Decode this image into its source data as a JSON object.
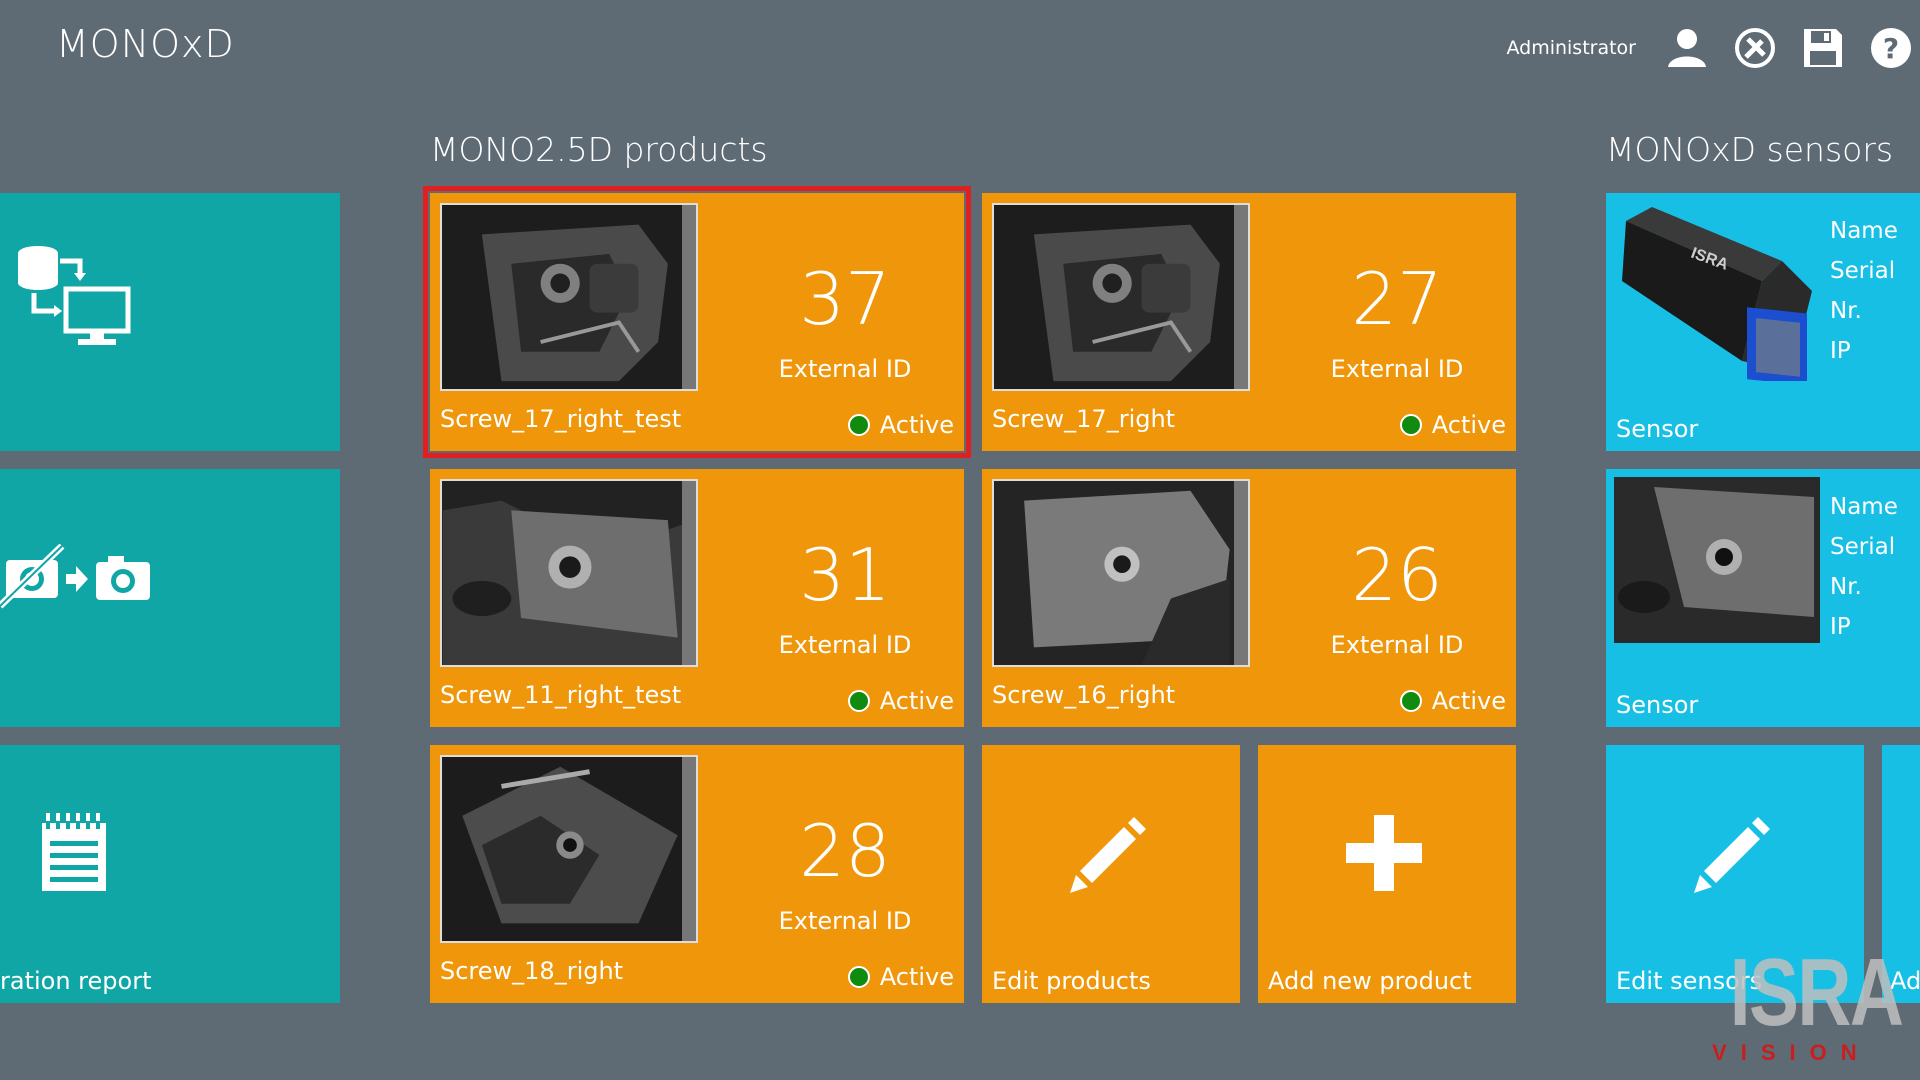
{
  "app": {
    "title": "MONOxD"
  },
  "header": {
    "user": "Administrator",
    "icons": [
      "user-icon",
      "tools-icon",
      "save-icon",
      "help-icon"
    ]
  },
  "left": {
    "tiles": [
      {
        "icon": "data-transfer-icon"
      },
      {
        "icon": "camera-replace-icon"
      },
      {
        "icon": "report-icon",
        "label": "ration report"
      }
    ]
  },
  "products": {
    "title": "MONO2.5D products",
    "items": [
      {
        "number": "37",
        "ext_label": "External ID",
        "name": "Screw_17_right_test",
        "status": "Active",
        "selected": true
      },
      {
        "number": "27",
        "ext_label": "External ID",
        "name": "Screw_17_right",
        "status": "Active"
      },
      {
        "number": "31",
        "ext_label": "External ID",
        "name": "Screw_11_right_test",
        "status": "Active"
      },
      {
        "number": "26",
        "ext_label": "External ID",
        "name": "Screw_16_right",
        "status": "Active"
      },
      {
        "number": "28",
        "ext_label": "External ID",
        "name": "Screw_18_right",
        "status": "Active"
      }
    ],
    "edit_label": "Edit products",
    "add_label": "Add new product"
  },
  "sensors": {
    "title": "MONOxD sensors",
    "items": [
      {
        "name_label": "Name",
        "serial_label": "Serial Nr.",
        "ip_label": "IP",
        "label": "Sensor"
      },
      {
        "name_label": "Name",
        "serial_label": "Serial Nr.",
        "ip_label": "IP",
        "label": "Sensor"
      }
    ],
    "edit_label": "Edit sensors",
    "add_label": "Ad"
  },
  "logo": {
    "main": "ISRA",
    "sub": "VISION"
  },
  "colors": {
    "background": "#5f6b74",
    "teal": "#10a6a6",
    "orange": "#ef960b",
    "cyan": "#18bfe5",
    "selection": "#e02020",
    "active": "#108b10"
  }
}
